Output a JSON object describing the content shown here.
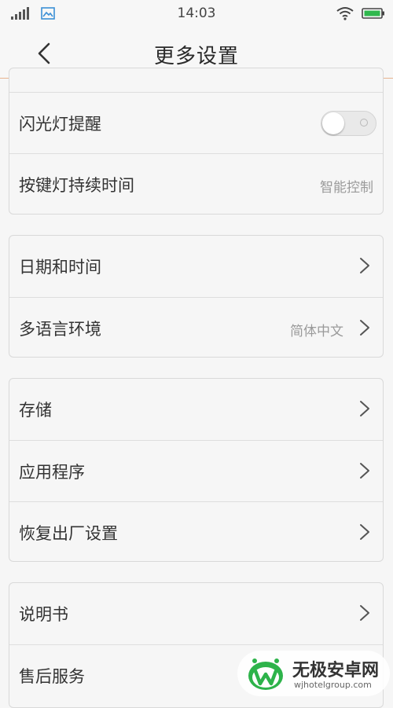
{
  "status_bar": {
    "time": "14:03"
  },
  "header": {
    "title": "更多设置"
  },
  "groups": [
    {
      "rows": [
        {
          "label": "闪光灯提醒",
          "toggle": false
        },
        {
          "label": "按键灯持续时间",
          "value": "智能控制"
        }
      ]
    },
    {
      "rows": [
        {
          "label": "日期和时间"
        },
        {
          "label": "多语言环境",
          "value": "简体中文"
        }
      ]
    },
    {
      "rows": [
        {
          "label": "存储"
        },
        {
          "label": "应用程序"
        },
        {
          "label": "恢复出厂设置"
        }
      ]
    },
    {
      "rows": [
        {
          "label": "说明书"
        },
        {
          "label": "售后服务"
        }
      ]
    }
  ],
  "watermark": {
    "name": "无极安卓网",
    "url": "wjhotelgroup.com"
  },
  "colors": {
    "accent_divider": "#e8b38e",
    "watermark_green": "#2db34a"
  }
}
